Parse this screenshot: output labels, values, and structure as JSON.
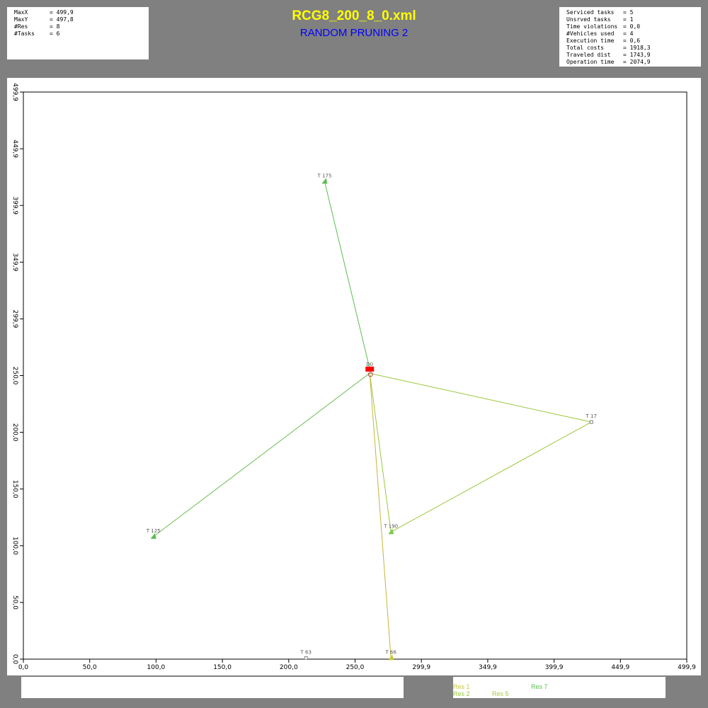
{
  "header": {
    "title": "RCG8_200_8_0.xml",
    "subtitle": "RANDOM PRUNING 2",
    "title_color": "#ffff00",
    "subtitle_color": "#0000ff"
  },
  "info_left": [
    {
      "key": "MaxX",
      "value": "= 499,9"
    },
    {
      "key": "MaxY",
      "value": "= 497,8"
    },
    {
      "key": "#Res",
      "value": "= 8"
    },
    {
      "key": "#Tasks",
      "value": "= 6"
    }
  ],
  "info_right": [
    {
      "key": "Serviced tasks",
      "value": "= 5"
    },
    {
      "key": "Unsrved tasks",
      "value": "= 1"
    },
    {
      "key": "Time violations",
      "value": "= 0,0"
    },
    {
      "key": "#Vehicles used",
      "value": "= 4"
    },
    {
      "key": "Execution time",
      "value": "= 0,6"
    },
    {
      "key": "Total costs",
      "value": "= 1918,3"
    },
    {
      "key": "Traveled dist",
      "value": "= 1743,9"
    },
    {
      "key": "Operation time",
      "value": "= 2074,9"
    }
  ],
  "legend": [
    {
      "label": "Res 1",
      "color": "#c8c83c"
    },
    {
      "label": "Res 7",
      "color": "#5abe50"
    },
    {
      "label": "Res 2",
      "color": "#9ac83c"
    },
    {
      "label": "Res 5",
      "color": "#aac83c"
    }
  ],
  "chart_data": {
    "type": "scatter",
    "xlim": [
      0,
      499.9
    ],
    "ylim": [
      0,
      499.9
    ],
    "x_ticks": [
      "0,0",
      "50,0",
      "100,0",
      "150,0",
      "200,0",
      "250,0",
      "299,9",
      "349,9",
      "399,9",
      "449,9",
      "499,9"
    ],
    "y_ticks": [
      "0,0",
      "50,0",
      "100,0",
      "150,0",
      "200,0",
      "250,0",
      "299,9",
      "349,9",
      "399,9",
      "449,9",
      "499,9"
    ],
    "depot": {
      "label": "D0",
      "x": 261,
      "y": 256,
      "color": "#ff0000"
    },
    "tasks": [
      {
        "label": "T 175",
        "x": 227,
        "y": 421,
        "color": "#5abe50",
        "marker": "triangle"
      },
      {
        "label": "T 17",
        "x": 428,
        "y": 209,
        "color": "#808080",
        "marker": "square"
      },
      {
        "label": "T 125",
        "x": 98,
        "y": 108,
        "color": "#5abe50",
        "marker": "triangle"
      },
      {
        "label": "T 190",
        "x": 277,
        "y": 112,
        "color": "#7ec850",
        "marker": "triangle"
      },
      {
        "label": "T 63",
        "x": 213,
        "y": 1,
        "color": "#808080",
        "marker": "square"
      },
      {
        "label": "T 66",
        "x": 277,
        "y": 1,
        "color": "#c8c83c",
        "marker": "triangle"
      }
    ],
    "routes": [
      {
        "name": "Res 7",
        "color": "#5abe50",
        "points": [
          [
            261,
            256
          ],
          [
            227,
            421
          ],
          [
            261,
            256
          ]
        ]
      },
      {
        "name": "Res 2",
        "color": "#9ac83c",
        "points": [
          [
            261,
            252
          ],
          [
            428,
            209
          ],
          [
            277,
            112
          ],
          [
            261,
            252
          ]
        ]
      },
      {
        "name": "Res 5",
        "color": "#6abe50",
        "points": [
          [
            261,
            252
          ],
          [
            98,
            108
          ]
        ]
      },
      {
        "name": "Res 1",
        "color": "#c8b43c",
        "points": [
          [
            261,
            252
          ],
          [
            277,
            1
          ],
          [
            261,
            252
          ]
        ]
      }
    ]
  }
}
